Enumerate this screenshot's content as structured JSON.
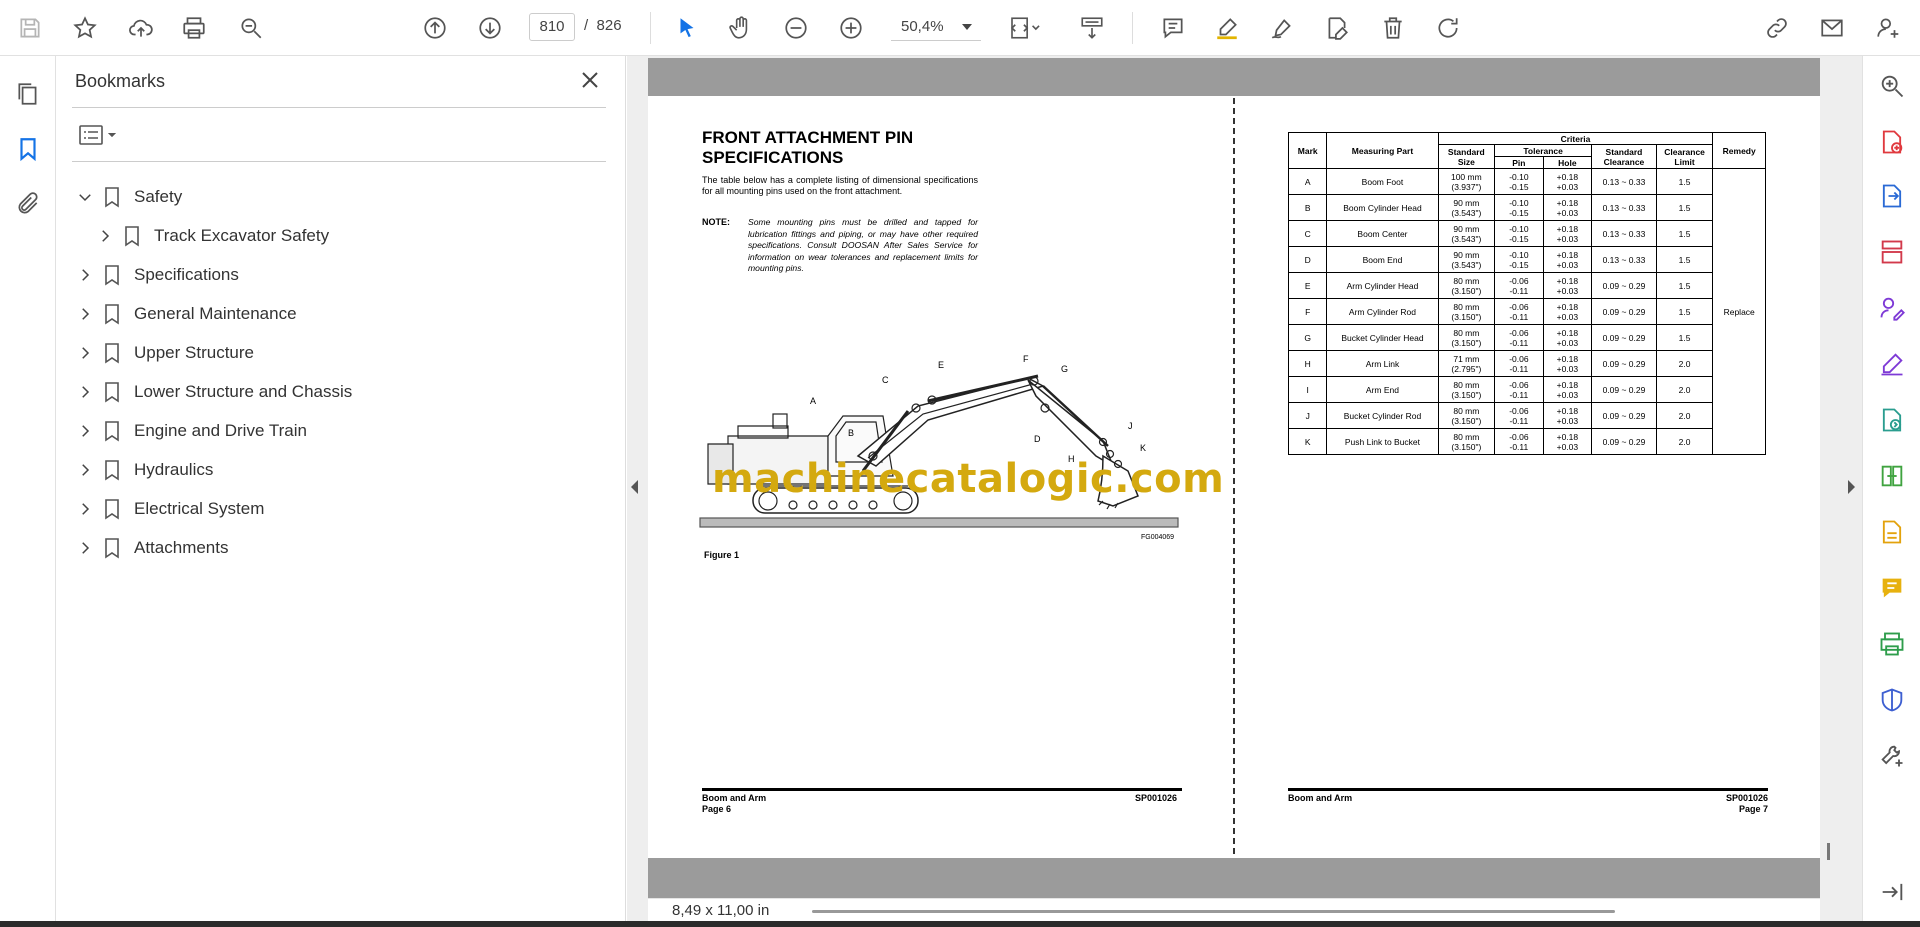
{
  "toolbar": {
    "current_page": "810",
    "page_separator": "/",
    "total_pages": "826",
    "zoom": "50,4%"
  },
  "bookmarks": {
    "title": "Bookmarks",
    "items": [
      {
        "label": "Safety",
        "expanded": true
      },
      {
        "label": "Track Excavator Safety",
        "child": true
      },
      {
        "label": "Specifications"
      },
      {
        "label": "General Maintenance"
      },
      {
        "label": "Upper Structure"
      },
      {
        "label": "Lower Structure and Chassis"
      },
      {
        "label": "Engine and Drive Train"
      },
      {
        "label": "Hydraulics"
      },
      {
        "label": "Electrical System"
      },
      {
        "label": "Attachments"
      }
    ]
  },
  "left_page": {
    "title_line1": "FRONT ATTACHMENT PIN",
    "title_line2": "SPECIFICATIONS",
    "intro": "The table below has a complete listing of dimensional specifications for all mounting pins used on the front attachment.",
    "note_label": "NOTE:",
    "note": "Some mounting pins must be drilled and tapped for lubrication fittings and piping, or may have other required specifications. Consult DOOSAN After Sales Service for information on wear tolerances and replacement limits for mounting pins.",
    "figure_code": "FG004069",
    "figure_caption": "Figure 1",
    "figure_labels": [
      "A",
      "B",
      "C",
      "D",
      "E",
      "F",
      "G",
      "H",
      "J",
      "K"
    ],
    "footer_left_1": "Boom and Arm",
    "footer_left_2": "Page 6",
    "footer_right": "SP001026"
  },
  "watermark": "machinecatalogic.com",
  "right_page": {
    "table": {
      "headers": {
        "mark": "Mark",
        "part": "Measuring Part",
        "criteria": "Criteria",
        "std_size": "Standard Size",
        "tolerance": "Tolerance",
        "pin": "Pin",
        "hole": "Hole",
        "std_clear": "Standard Clearance",
        "clear_limit": "Clearance Limit",
        "remedy": "Remedy"
      },
      "remedy_value": "Replace",
      "rows": [
        {
          "mark": "A",
          "part": "Boom Foot",
          "size1": "100 mm",
          "size2": "(3.937\")",
          "pin1": "-0.10",
          "pin2": "-0.15",
          "hole1": "+0.18",
          "hole2": "+0.03",
          "clear": "0.13 ~ 0.33",
          "limit": "1.5"
        },
        {
          "mark": "B",
          "part": "Boom Cylinder Head",
          "size1": "90 mm",
          "size2": "(3.543\")",
          "pin1": "-0.10",
          "pin2": "-0.15",
          "hole1": "+0.18",
          "hole2": "+0.03",
          "clear": "0.13 ~ 0.33",
          "limit": "1.5"
        },
        {
          "mark": "C",
          "part": "Boom Center",
          "size1": "90 mm",
          "size2": "(3.543\")",
          "pin1": "-0.10",
          "pin2": "-0.15",
          "hole1": "+0.18",
          "hole2": "+0.03",
          "clear": "0.13 ~ 0.33",
          "limit": "1.5"
        },
        {
          "mark": "D",
          "part": "Boom End",
          "size1": "90 mm",
          "size2": "(3.543\")",
          "pin1": "-0.10",
          "pin2": "-0.15",
          "hole1": "+0.18",
          "hole2": "+0.03",
          "clear": "0.13 ~ 0.33",
          "limit": "1.5"
        },
        {
          "mark": "E",
          "part": "Arm Cylinder Head",
          "size1": "80 mm",
          "size2": "(3.150\")",
          "pin1": "-0.06",
          "pin2": "-0.11",
          "hole1": "+0.18",
          "hole2": "+0.03",
          "clear": "0.09 ~ 0.29",
          "limit": "1.5"
        },
        {
          "mark": "F",
          "part": "Arm Cylinder Rod",
          "size1": "80 mm",
          "size2": "(3.150\")",
          "pin1": "-0.06",
          "pin2": "-0.11",
          "hole1": "+0.18",
          "hole2": "+0.03",
          "clear": "0.09 ~ 0.29",
          "limit": "1.5"
        },
        {
          "mark": "G",
          "part": "Bucket Cylinder Head",
          "size1": "80 mm",
          "size2": "(3.150\")",
          "pin1": "-0.06",
          "pin2": "-0.11",
          "hole1": "+0.18",
          "hole2": "+0.03",
          "clear": "0.09 ~ 0.29",
          "limit": "1.5"
        },
        {
          "mark": "H",
          "part": "Arm Link",
          "size1": "71 mm",
          "size2": "(2.795\")",
          "pin1": "-0.06",
          "pin2": "-0.11",
          "hole1": "+0.18",
          "hole2": "+0.03",
          "clear": "0.09 ~ 0.29",
          "limit": "2.0"
        },
        {
          "mark": "I",
          "part": "Arm End",
          "size1": "80 mm",
          "size2": "(3.150\")",
          "pin1": "-0.06",
          "pin2": "-0.11",
          "hole1": "+0.18",
          "hole2": "+0.03",
          "clear": "0.09 ~ 0.29",
          "limit": "2.0"
        },
        {
          "mark": "J",
          "part": "Bucket Cylinder Rod",
          "size1": "80 mm",
          "size2": "(3.150\")",
          "pin1": "-0.06",
          "pin2": "-0.11",
          "hole1": "+0.18",
          "hole2": "+0.03",
          "clear": "0.09 ~ 0.29",
          "limit": "2.0"
        },
        {
          "mark": "K",
          "part": "Push Link to Bucket",
          "size1": "80 mm",
          "size2": "(3.150\")",
          "pin1": "-0.06",
          "pin2": "-0.11",
          "hole1": "+0.18",
          "hole2": "+0.03",
          "clear": "0.09 ~ 0.29",
          "limit": "2.0"
        }
      ]
    },
    "footer_left": "Boom and Arm",
    "footer_right_1": "SP001026",
    "footer_right_2": "Page 7"
  },
  "status": {
    "dimensions": "8,49 x 11,00 in"
  },
  "colors": {
    "accent_blue": "#1473e6",
    "page_gray": "#9b9b9b",
    "watermark": "#d4a90f"
  }
}
